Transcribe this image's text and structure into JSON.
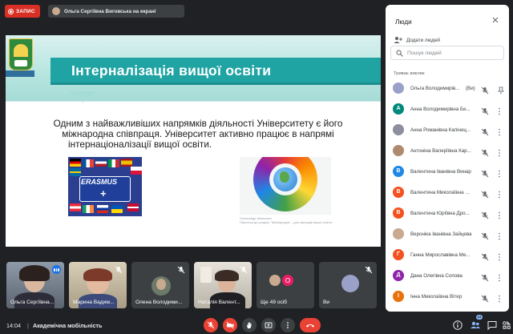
{
  "recording": {
    "label": "ЗАПИС"
  },
  "presenter": {
    "text": "Ольга Сергіївна Виговська на екрані"
  },
  "slide": {
    "title": "Інтерналізація вищої освіти",
    "body_line1": "Одним з найважливіших напрямків діяльності Університету є його",
    "body_line2": "міжнародна співпраця. Університет активно працює в напрямі",
    "body_line3": "інтернаціоналізації вищої освіти.",
    "erasmus_text": "ERASMUS",
    "erasmus_plus": "+",
    "caption_line1": "Олександр Шевченко",
    "caption_line2": "Пам'ятка до розділу \"Міжнародна\" - для закладів вищої освіти"
  },
  "tiles": [
    {
      "name": "Ольга Сергіївна..."
    },
    {
      "name": "Марина Вадим..."
    },
    {
      "name": "Олена Володими..."
    },
    {
      "name": "Наталія Валент..."
    },
    {
      "name": "Ще 49 осіб"
    },
    {
      "name": "Ви"
    }
  ],
  "tile_badge": "О",
  "bottom": {
    "time": "14:04",
    "separator": "|",
    "meeting_name": "Академічна мобільність",
    "people_count": "64"
  },
  "panel": {
    "title": "Люди",
    "add_people": "Додати людей",
    "search_placeholder": "Пошук людей",
    "section": "Триває виклик",
    "people": [
      {
        "name": "Ольга Володимирів...",
        "suffix": "(Ви)",
        "initial": "",
        "color": "#9aa0c8"
      },
      {
        "name": "Анна Володимирівна Бе...",
        "suffix": "",
        "initial": "А",
        "color": "#00897b"
      },
      {
        "name": "Анна Романівна Капінец...",
        "suffix": "",
        "initial": "",
        "color": "#8d8f9e"
      },
      {
        "name": "Антоніна Валеріївна Кар...",
        "suffix": "",
        "initial": "",
        "color": "#b08a6e"
      },
      {
        "name": "Валентина Іванівна Винар",
        "suffix": "",
        "initial": "В",
        "color": "#1e88e5"
      },
      {
        "name": "Валентина Миколаївна Б...",
        "suffix": "",
        "initial": "В",
        "color": "#f4511e"
      },
      {
        "name": "Валентина Юріївна Дро...",
        "suffix": "",
        "initial": "В",
        "color": "#f4511e"
      },
      {
        "name": "Вероніка Іванівна Зайцева",
        "suffix": "",
        "initial": "",
        "color": "#c9a98f"
      },
      {
        "name": "Ганна Мирославівна Ме...",
        "suffix": "",
        "initial": "Г",
        "color": "#f4511e"
      },
      {
        "name": "Дана Олегівна Сопова",
        "suffix": "",
        "initial": "Д",
        "color": "#8e24aa"
      },
      {
        "name": "Інна Миколаївна Вітер",
        "suffix": "",
        "initial": "І",
        "color": "#e8710a"
      }
    ]
  }
}
